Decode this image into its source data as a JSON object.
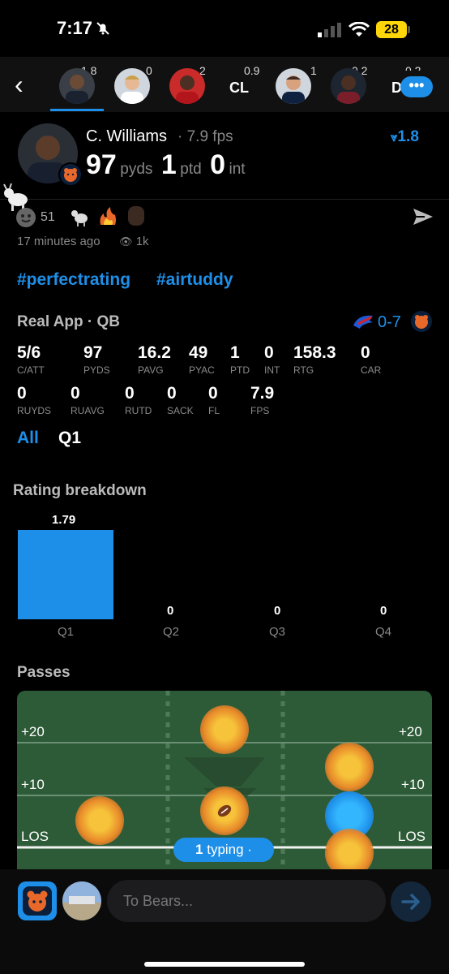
{
  "status": {
    "time": "7:17",
    "battery": "28"
  },
  "nav": {
    "players": [
      {
        "value": "1.8",
        "name": "player-tab-williams"
      },
      {
        "value": "0",
        "name": "player-tab-2"
      },
      {
        "value": "2",
        "name": "player-tab-3"
      },
      {
        "value": "0.9",
        "badge": "CL",
        "name": "player-tab-cl"
      },
      {
        "value": "1",
        "name": "player-tab-5"
      },
      {
        "value": "0.2",
        "name": "player-tab-6"
      },
      {
        "value": "0.2",
        "badge": "D",
        "name": "player-tab-d"
      }
    ]
  },
  "post": {
    "player_name": "C. Williams",
    "fps_text": "· 7.9 fps",
    "rating_badge": "1.8",
    "pyds_value": "97",
    "pyds_label": "pyds",
    "ptd_value": "1",
    "ptd_label": "ptd",
    "int_value": "0",
    "int_label": "int",
    "reactions_count": "51",
    "time_ago": "17 minutes ago",
    "views": "1k",
    "hashtags": [
      "#perfectrating",
      "#airtuddy"
    ]
  },
  "game": {
    "title": "Real App · QB",
    "score": "0-7",
    "stats_row1": [
      {
        "v": "5/6",
        "l": "C/ATT"
      },
      {
        "v": "97",
        "l": "PYDS"
      },
      {
        "v": "16.2",
        "l": "PAVG"
      },
      {
        "v": "49",
        "l": "PYAC"
      },
      {
        "v": "1",
        "l": "PTD"
      },
      {
        "v": "0",
        "l": "INT"
      },
      {
        "v": "158.3",
        "l": "RTG"
      },
      {
        "v": "0",
        "l": "CAR"
      }
    ],
    "stats_row2": [
      {
        "v": "0",
        "l": "RUYDS"
      },
      {
        "v": "0",
        "l": "RUAVG"
      },
      {
        "v": "0",
        "l": "RUTD"
      },
      {
        "v": "0",
        "l": "SACK"
      },
      {
        "v": "0",
        "l": "FL"
      },
      {
        "v": "7.9",
        "l": "FPS"
      }
    ],
    "filters": [
      "All",
      "Q1"
    ]
  },
  "rating": {
    "heading": "Rating breakdown",
    "labels": [
      "1.79",
      "0",
      "0",
      "0"
    ]
  },
  "chart_data": {
    "type": "bar",
    "categories": [
      "Q1",
      "Q2",
      "Q3",
      "Q4"
    ],
    "values": [
      1.79,
      0,
      0,
      0
    ],
    "title": "Rating breakdown",
    "colors": {
      "bar": "#1e8fe8"
    }
  },
  "passes": {
    "heading": "Passes",
    "left_labels": [
      "+20",
      "+10",
      "LOS"
    ],
    "right_labels": [
      "+20",
      "+10",
      "LOS"
    ],
    "typing_count": "1",
    "typing_text": "typing ·"
  },
  "composer": {
    "placeholder": "To Bears..."
  },
  "colors": {
    "accent": "#1e8fe8",
    "field": "#2e5b37",
    "bears_orange": "#e8682a",
    "bears_navy": "#0b1f3a"
  }
}
